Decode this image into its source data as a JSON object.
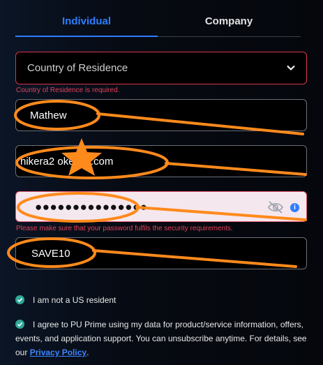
{
  "tabs": {
    "individual": "Individual",
    "company": "Company"
  },
  "form": {
    "country_placeholder": "Country of Residence",
    "country_error": "Country of Residence is required.",
    "name_value": "Mathew",
    "email_value": "hikera2 okexbit.com",
    "password_mask": "●●●●●●●●●●●●●●●",
    "password_error": "Please make sure that your password fulfils the security requirements.",
    "promo_value": "SAVE10"
  },
  "checks": {
    "us_resident": "I am not a US resident",
    "agree_text": "I agree to PU Prime using my data for product/service information, offers, events, and application support. You can unsubscribe anytime. For details, see our",
    "privacy_link": "Privacy Policy",
    "agree_end": "."
  },
  "colors": {
    "accent": "#2f7dff",
    "error": "#e2425a",
    "check": "#2fa89a",
    "annotation": "#ff8a1c"
  },
  "icons": [
    "chevron-down-icon",
    "eye-off-icon",
    "info-icon",
    "check-icon",
    "star-icon"
  ]
}
